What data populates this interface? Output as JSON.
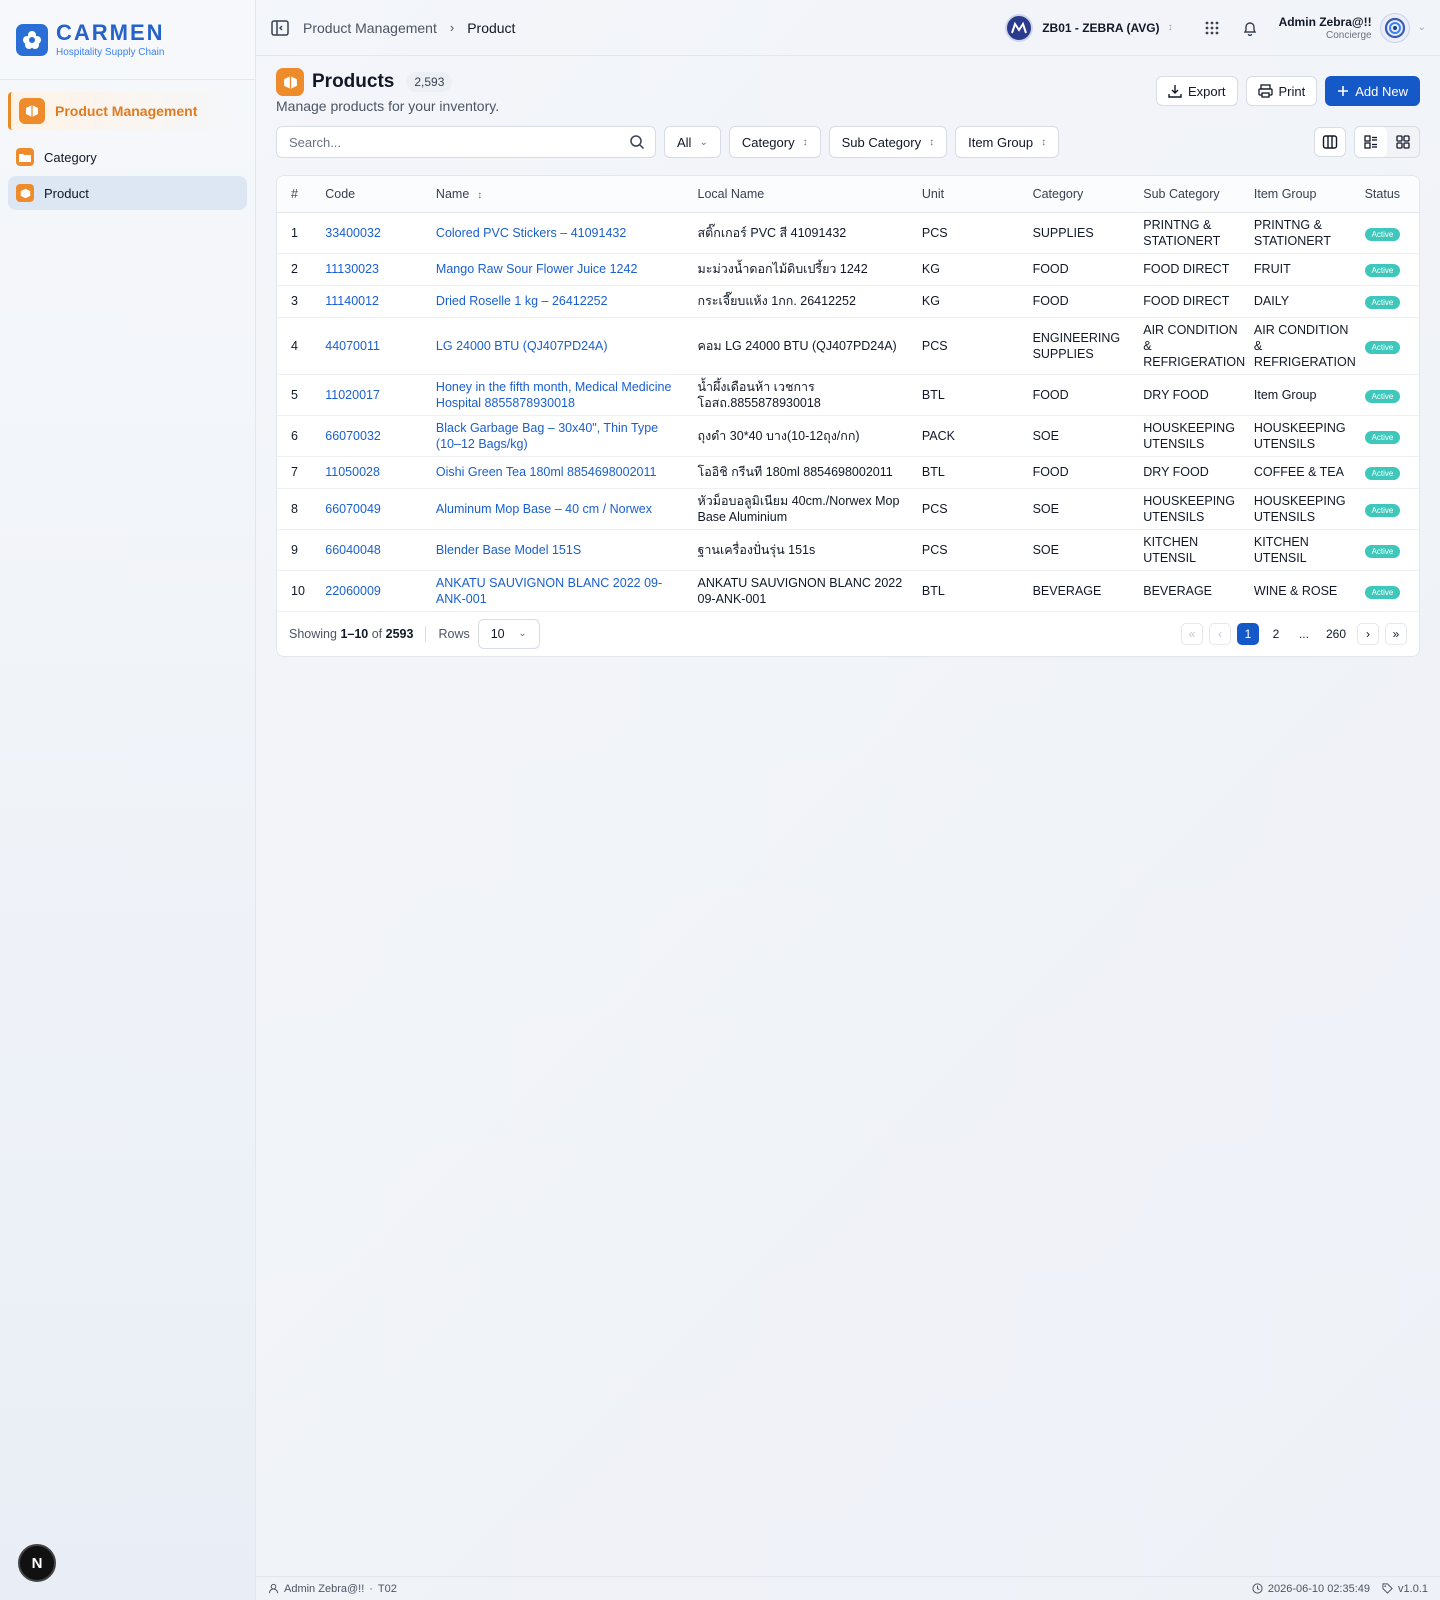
{
  "brand": {
    "name": "CARMEN",
    "tagline": "Hospitality Supply Chain"
  },
  "sidebar": {
    "module": "Product Management",
    "items": [
      {
        "label": "Category",
        "active": false
      },
      {
        "label": "Product",
        "active": true
      }
    ],
    "bottom_badge": "N"
  },
  "header": {
    "breadcrumb": [
      "Product Management",
      "Product"
    ],
    "business_unit": "ZB01 - ZEBRA (AVG)",
    "user_name": "Admin Zebra@!!",
    "user_role": "Concierge"
  },
  "page": {
    "title": "Products",
    "count": "2,593",
    "subtitle": "Manage products for your inventory.",
    "actions": {
      "export": "Export",
      "print": "Print",
      "add": "Add New"
    }
  },
  "filters": {
    "search_placeholder": "Search...",
    "status": "All",
    "category": "Category",
    "sub_category": "Sub Category",
    "item_group": "Item Group"
  },
  "table": {
    "columns": [
      "#",
      "Code",
      "Name",
      "Local Name",
      "Unit",
      "Category",
      "Sub Category",
      "Item Group",
      "Status"
    ],
    "rows": [
      {
        "no": "1",
        "code": "33400032",
        "name": "Colored PVC Stickers – 41091432",
        "local": "สติ๊กเกอร์ PVC สี 41091432",
        "unit": "PCS",
        "category": "SUPPLIES",
        "sub": "PRINTNG & STATIONERT",
        "group": "PRINTNG & STATIONERT",
        "status": "Active"
      },
      {
        "no": "2",
        "code": "11130023",
        "name": "Mango Raw Sour Flower Juice 1242",
        "local": "มะม่วงน้ำดอกไม้ดิบเปรี้ยว 1242",
        "unit": "KG",
        "category": "FOOD",
        "sub": "FOOD DIRECT",
        "group": "FRUIT",
        "status": "Active"
      },
      {
        "no": "3",
        "code": "11140012",
        "name": "Dried Roselle 1 kg – 26412252",
        "local": "กระเจี๊ยบแห้ง 1กก. 26412252",
        "unit": "KG",
        "category": "FOOD",
        "sub": "FOOD DIRECT",
        "group": "DAILY",
        "status": "Active"
      },
      {
        "no": "4",
        "code": "44070011",
        "name": "LG 24000 BTU (QJ407PD24A)",
        "local": "คอม LG 24000 BTU (QJ407PD24A)",
        "unit": "PCS",
        "category": "ENGINEERING SUPPLIES",
        "sub": "AIR CONDITION & REFRIGERATION",
        "group": "AIR CONDITION & REFRIGERATION",
        "status": "Active"
      },
      {
        "no": "5",
        "code": "11020017",
        "name": "Honey in the fifth month, Medical Medicine Hospital 8855878930018",
        "local": "น้ำผึ้งเดือนห้า เวชการ โอสถ.8855878930018",
        "unit": "BTL",
        "category": "FOOD",
        "sub": "DRY FOOD",
        "group": "Item Group",
        "status": "Active"
      },
      {
        "no": "6",
        "code": "66070032",
        "name": "Black Garbage Bag – 30x40\", Thin Type (10–12 Bags/kg)",
        "local": "ถุงดำ 30*40 บาง(10-12ถุง/กก)",
        "unit": "PACK",
        "category": "SOE",
        "sub": "HOUSKEEPING UTENSILS",
        "group": "HOUSKEEPING UTENSILS",
        "status": "Active"
      },
      {
        "no": "7",
        "code": "11050028",
        "name": "Oishi Green Tea 180ml 8854698002011",
        "local": "โออิชิ กรีนที 180ml  8854698002011",
        "unit": "BTL",
        "category": "FOOD",
        "sub": "DRY FOOD",
        "group": "COFFEE & TEA",
        "status": "Active"
      },
      {
        "no": "8",
        "code": "66070049",
        "name": "Aluminum Mop Base – 40 cm / Norwex",
        "local": "หัวม็อบอลูมิเนียม 40cm./Norwex Mop Base Aluminium",
        "unit": "PCS",
        "category": "SOE",
        "sub": "HOUSKEEPING UTENSILS",
        "group": "HOUSKEEPING UTENSILS",
        "status": "Active"
      },
      {
        "no": "9",
        "code": "66040048",
        "name": "Blender Base Model 151S",
        "local": "ฐานเครื่องปั่นรุ่น 151s",
        "unit": "PCS",
        "category": "SOE",
        "sub": "KITCHEN UTENSIL",
        "group": "KITCHEN UTENSIL",
        "status": "Active"
      },
      {
        "no": "10",
        "code": "22060009",
        "name": "ANKATU SAUVIGNON BLANC 2022 09-ANK-001",
        "local": "ANKATU SAUVIGNON BLANC 2022 09-ANK-001",
        "unit": "BTL",
        "category": "BEVERAGE",
        "sub": "BEVERAGE",
        "group": "WINE & ROSE",
        "status": "Active"
      }
    ]
  },
  "pagination": {
    "showing_label": "Showing",
    "range": "1–10",
    "of_label": "of",
    "total": "2593",
    "rows_label": "Rows",
    "rows_value": "10",
    "pages": [
      "1",
      "2",
      "...",
      "260"
    ],
    "current_page": "1"
  },
  "statusbar": {
    "user": "Admin Zebra@!!",
    "code": "T02",
    "datetime": "2026-06-10 02:35:49",
    "version": "v1.0.1"
  },
  "colors": {
    "primary": "#1558c7",
    "accent": "#ee8c2c",
    "link": "#1a5fd0",
    "status_active": "#3ec7bb"
  }
}
